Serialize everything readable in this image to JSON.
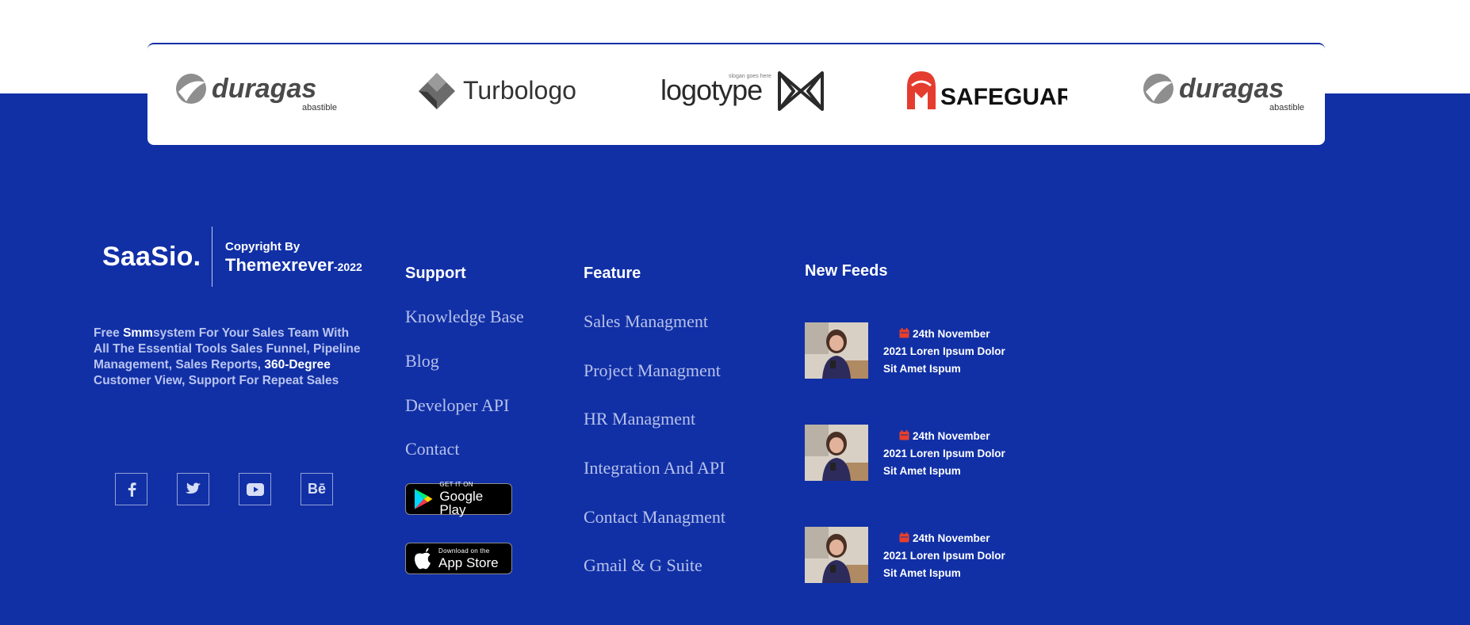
{
  "partners": {
    "logos": [
      {
        "name": "duragas",
        "sub": "abastible",
        "icon": "duragas-logo"
      },
      {
        "name": "Turbologo",
        "icon": "turbologo-logo"
      },
      {
        "name": "logotype",
        "tagline": "slogan goes here",
        "icon": "logotype-logo"
      },
      {
        "name": "SAFEGUARD",
        "icon": "safeguard-logo"
      },
      {
        "name": "duragas",
        "sub": "abastible",
        "icon": "duragas-logo"
      }
    ]
  },
  "about": {
    "site_name": "SaaSio.",
    "copyright_label": "Copyright By",
    "copyright_brand": "Themexrever",
    "copyright_year": "-2022",
    "desc_1": "Free ",
    "desc_hl_1": "Smm",
    "desc_2": "system For Your Sales Team With All The Essential Tools Sales Funnel, Pipeline Management, Sales Reports, ",
    "desc_hl_2": "360-Degree",
    "desc_3": " Customer View, Support For Repeat Sales"
  },
  "social": [
    {
      "label": "f",
      "icon": "facebook-icon"
    },
    {
      "label": "t",
      "icon": "twitter-icon"
    },
    {
      "label": "yt",
      "icon": "youtube-icon"
    },
    {
      "label": "Bē",
      "icon": "behance-icon"
    }
  ],
  "support": {
    "title": "Support",
    "links": [
      "Knowledge Base",
      "Blog",
      "Developer API",
      "Contact"
    ]
  },
  "stores": {
    "google_small": "GET IT ON",
    "google_big": "Google Play",
    "apple_small": "Download on the",
    "apple_big": "App Store"
  },
  "feature": {
    "title": "Feature",
    "links": [
      "Sales Managment",
      "Project Managment",
      "HR Managment",
      "Integration And API",
      "Contact Managment",
      "Gmail & G Suite"
    ]
  },
  "feeds": {
    "title": "New Feeds",
    "items": [
      {
        "date": "24th November",
        "text": "2021 Loren Ipsum Dolor Sit Amet Ispum"
      },
      {
        "date": "24th November",
        "text": "2021 Loren Ipsum Dolor Sit Amet Ispum"
      },
      {
        "date": "24th November",
        "text": "2021 Loren Ipsum Dolor Sit Amet Ispum"
      }
    ]
  },
  "colors": {
    "footer_bg": "#1130a6",
    "link": "#b7c1ea",
    "calendar": "#e8402a"
  }
}
